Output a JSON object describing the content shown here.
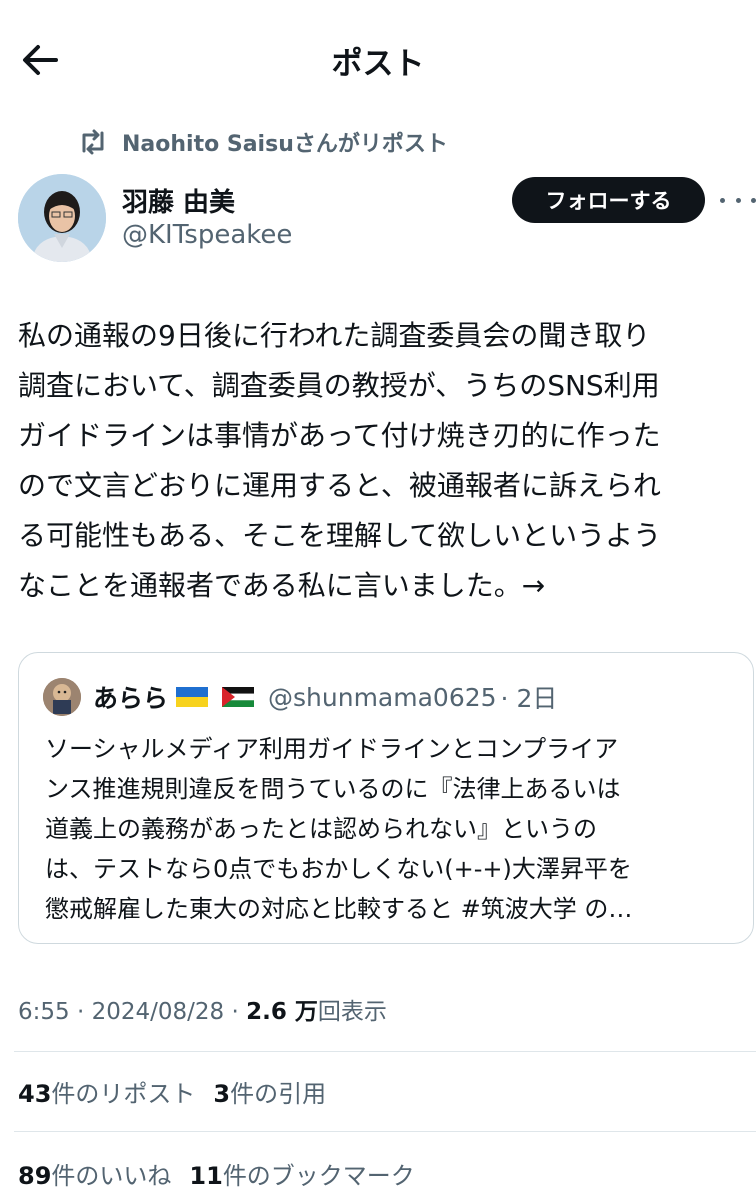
{
  "header": {
    "title": "ポスト"
  },
  "repost": {
    "text": "Naohito Saisuさんがリポスト"
  },
  "author": {
    "name": "羽藤 由美",
    "handle": "@KITspeakee"
  },
  "follow": {
    "label": "フォローする"
  },
  "tweet": {
    "text": "私の通報の9日後に行われた調査委員会の聞き取り\n調査において、調査委員の教授が、うちのSNS利用\nガイドラインは事情があって付け焼き刃的に作った\nので文言どおりに運用すると、被通報者に訴えられ\nる可能性もある、そこを理解して欲しいというよう\nなことを通報者である私に言いました。→"
  },
  "quote": {
    "name": "あらら",
    "flags": [
      "ukraine-flag",
      "palestine-flag"
    ],
    "handle": "@shunmama0625",
    "time": "· 2日",
    "text": "ソーシャルメディア利用ガイドラインとコンプライア\nンス推進規則違反を問うているのに『法律上あるいは\n道義上の義務があったとは認められない』というの\nは、テストなら0点でもおかしくない(+-+)大澤昇平を\n懲戒解雇した東大の対応と比較すると #筑波大学 の…"
  },
  "meta": {
    "time": "6:55 · 2024/08/28 · ",
    "views_count": "2.6 万",
    "views_label": "回表示"
  },
  "stats": {
    "reposts_count": "43",
    "reposts_label": "件のリポスト",
    "quotes_count": "3",
    "quotes_label": "件の引用",
    "likes_count": "89",
    "likes_label": "件のいいね",
    "bookmarks_count": "11",
    "bookmarks_label": "件のブックマーク"
  },
  "colors": {
    "text": "#0f1419",
    "secondary": "#536471",
    "border": "#cfd9de",
    "button_bg": "#0f1419"
  }
}
